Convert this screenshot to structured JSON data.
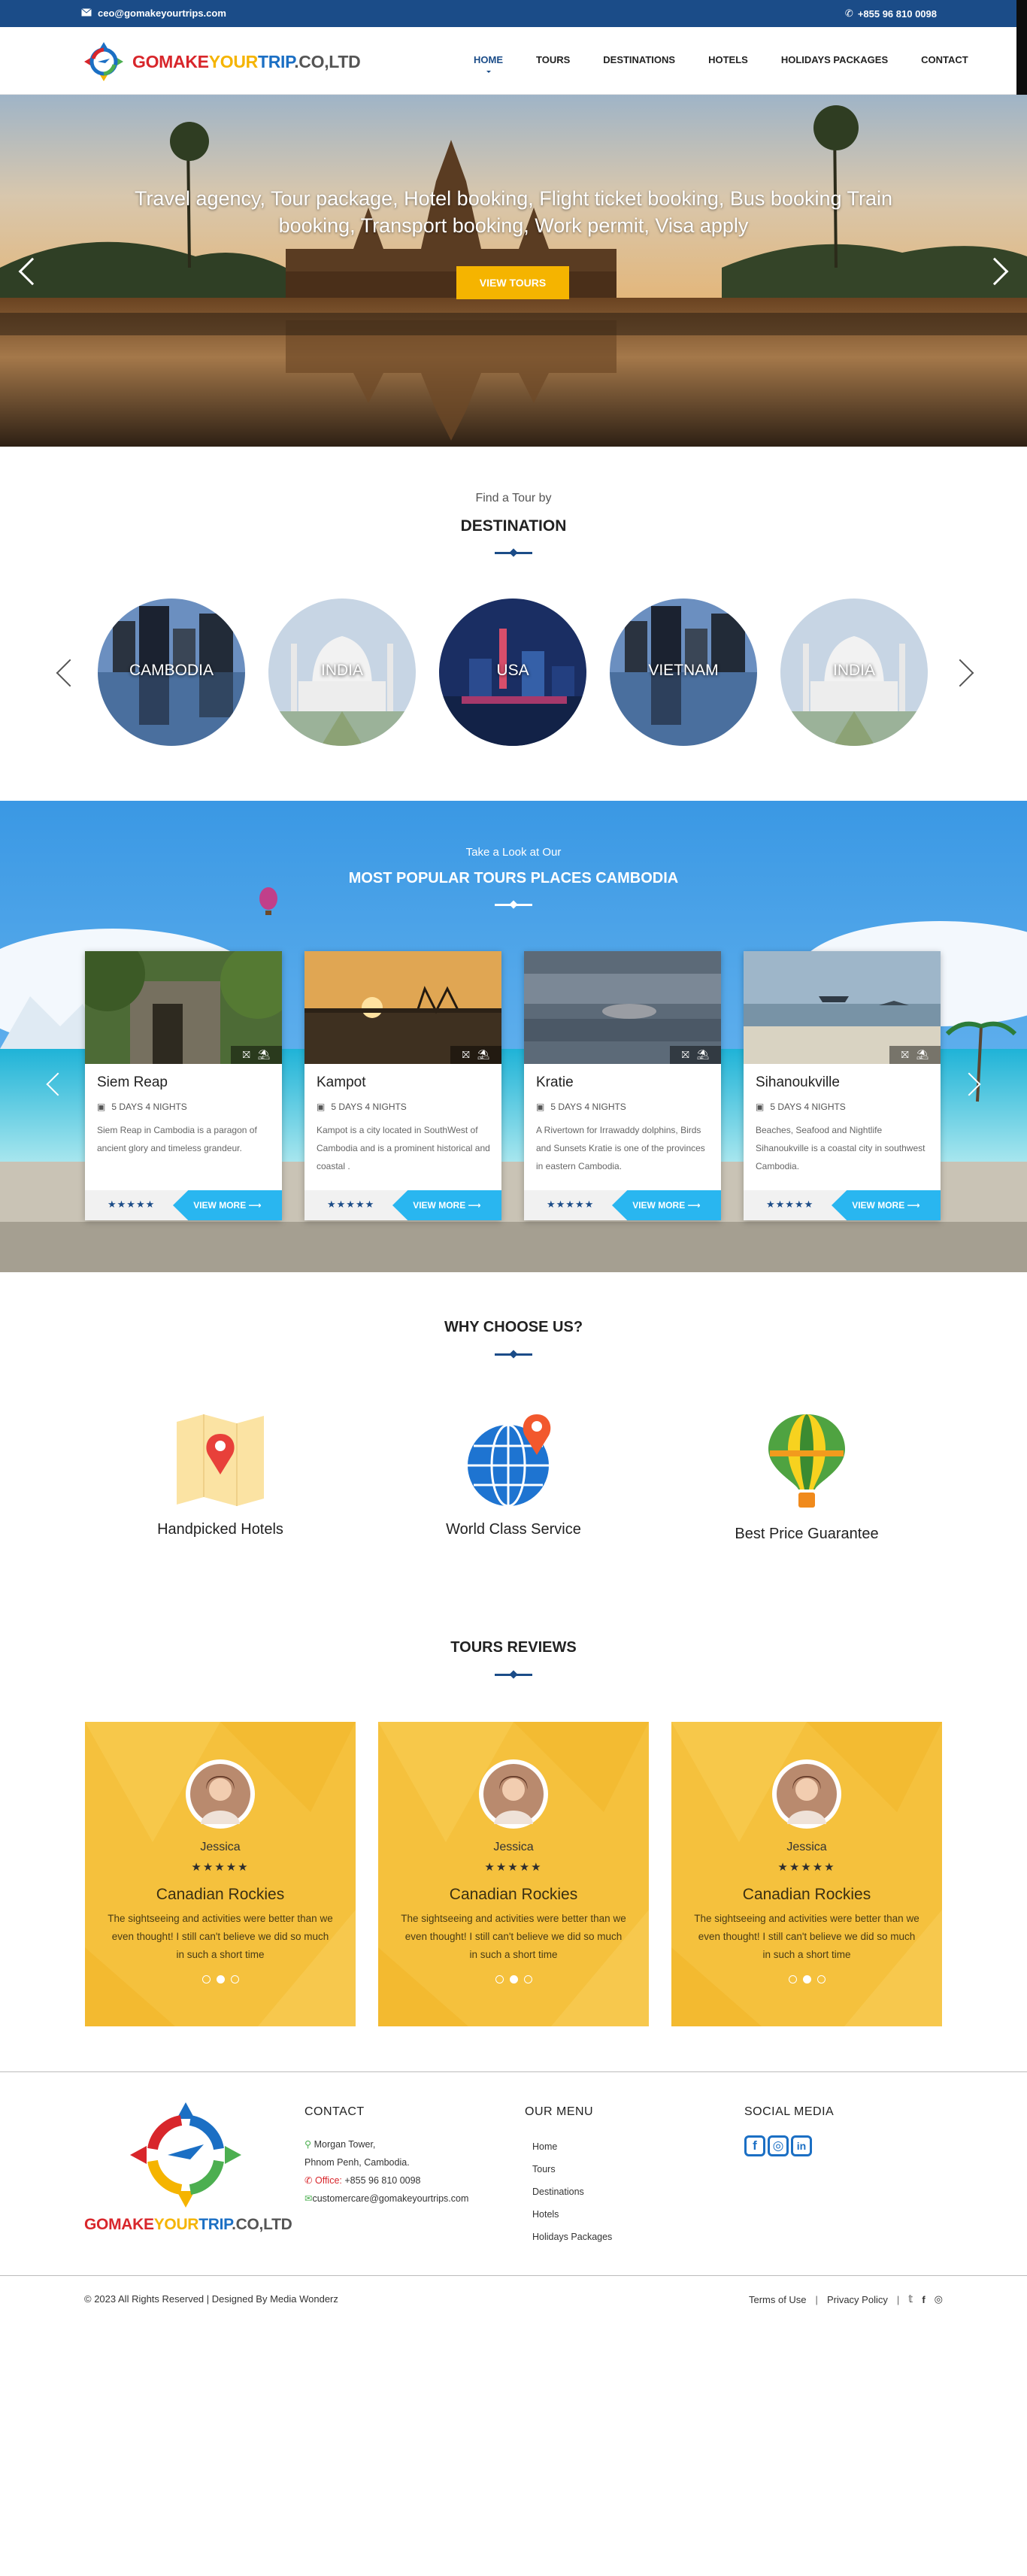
{
  "topbar": {
    "email": "ceo@gomakeyourtrips.com",
    "phone": "+855 96 810 0098"
  },
  "brand": {
    "part1": "GOMAKE",
    "part2": "YOUR",
    "part3": "TRIP",
    "part4": ".CO,LTD",
    "color1": "#d8262b",
    "color2": "#f5b400",
    "color3": "#1b6fc4"
  },
  "nav": {
    "items": [
      "HOME",
      "TOURS",
      "DESTINATIONS",
      "HOTELS",
      "HOLIDAYS PACKAGES",
      "CONTACT"
    ],
    "active": "HOME"
  },
  "hero": {
    "headline": "Travel agency, Tour package, Hotel booking, Flight ticket booking, Bus booking Train booking, Transport booking, Work permit, Visa apply",
    "button": "VIEW TOURS"
  },
  "destinations": {
    "subtitle": "Find a Tour by",
    "title": "DESTINATION",
    "items": [
      "CAMBODIA",
      "INDIA",
      "USA",
      "VIETNAM",
      "INDIA"
    ]
  },
  "popular": {
    "subtitle": "Take a Look at Our",
    "title": "MOST POPULAR TOURS PLACES CAMBODIA",
    "cards": [
      {
        "name": "Siem Reap",
        "duration": "5 DAYS 4 NIGHTS",
        "desc": "Siem Reap in Cambodia is a paragon of ancient glory and timeless grandeur.",
        "stars": "★★★★★",
        "cta": "VIEW MORE ⟶"
      },
      {
        "name": "Kampot",
        "duration": "5 DAYS 4 NIGHTS",
        "desc": "Kampot is a city located in SouthWest of Cambodia and is a prominent historical and coastal .",
        "stars": "★★★★★",
        "cta": "VIEW MORE ⟶"
      },
      {
        "name": "Kratie",
        "duration": "5 DAYS 4 NIGHTS",
        "desc": "A Rivertown for Irrawaddy dolphins, Birds and Sunsets Kratie is one of the provinces in eastern Cambodia.",
        "stars": "★★★★★",
        "cta": "VIEW MORE ⟶"
      },
      {
        "name": "Sihanoukville",
        "duration": "5 DAYS 4 NIGHTS",
        "desc": "Beaches, Seafood and Nightlife Sihanoukville is a coastal city in southwest Cambodia.",
        "stars": "★★★★★",
        "cta": "VIEW MORE ⟶"
      }
    ]
  },
  "why": {
    "title": "WHY CHOOSE US?",
    "items": [
      "Handpicked Hotels",
      "World Class Service",
      "Best Price Guarantee"
    ]
  },
  "reviews": {
    "title": "TOURS REVIEWS",
    "items": [
      {
        "name": "Jessica",
        "stars": "★★★★★",
        "title": "Canadian Rockies",
        "text": "The sightseeing and activities were better than we even thought! I still can't believe we did so much in such a short time"
      },
      {
        "name": "Jessica",
        "stars": "★★★★★",
        "title": "Canadian Rockies",
        "text": "The sightseeing and activities were better than we even thought! I still can't believe we did so much in such a short time"
      },
      {
        "name": "Jessica",
        "stars": "★★★★★",
        "title": "Canadian Rockies",
        "text": "The sightseeing and activities were better than we even thought! I still can't believe we did so much in such a short time"
      }
    ]
  },
  "footer": {
    "contact_title": "CONTACT",
    "address1": "Morgan Tower,",
    "address2": "Phnom Penh, Cambodia.",
    "office_label": "Office:",
    "office_phone": "+855 96 810 0098",
    "email": "customercare@gomakeyourtrips.com",
    "menu_title": "OUR MENU",
    "menu": [
      "Home",
      "Tours",
      "Destinations",
      "Hotels",
      "Holidays Packages"
    ],
    "social_title": "SOCIAL MEDIA",
    "social": [
      "f",
      "◎",
      "in"
    ],
    "copyright": "© 2023 All Rights Reserved | Designed By Media Wonderz",
    "terms": "Terms of Use",
    "privacy": "Privacy Policy",
    "sep": "|",
    "icons": [
      "twitter-icon",
      "facebook-icon",
      "instagram-icon"
    ]
  }
}
